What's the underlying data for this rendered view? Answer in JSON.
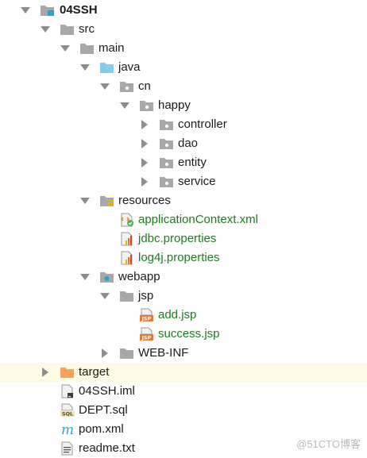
{
  "colors": {
    "folder": "#a8a8a8",
    "source_folder": "#82cdea",
    "excluded_folder": "#f3a35c",
    "module_badge": "#1fa7db",
    "selected_row": "#fdfbe3",
    "vcs_added_text": "#1e7b1e",
    "arrow": "#8e8e8e"
  },
  "tree": {
    "root": {
      "label": "04SSH",
      "icon": "module-folder-icon"
    },
    "src": {
      "label": "src",
      "icon": "folder-icon"
    },
    "main": {
      "label": "main",
      "icon": "folder-icon"
    },
    "java": {
      "label": "java",
      "icon": "source-root-folder-icon"
    },
    "cn": {
      "label": "cn",
      "icon": "package-icon"
    },
    "happy": {
      "label": "happy",
      "icon": "package-icon"
    },
    "controller": {
      "label": "controller",
      "icon": "package-icon"
    },
    "dao": {
      "label": "dao",
      "icon": "package-icon"
    },
    "entity": {
      "label": "entity",
      "icon": "package-icon"
    },
    "service": {
      "label": "service",
      "icon": "package-icon"
    },
    "resources": {
      "label": "resources",
      "icon": "resources-root-folder-icon"
    },
    "applicationContext": {
      "label": "applicationContext.xml",
      "icon": "spring-xml-file-icon"
    },
    "jdbc": {
      "label": "jdbc.properties",
      "icon": "properties-file-icon"
    },
    "log4j": {
      "label": "log4j.properties",
      "icon": "properties-file-icon"
    },
    "webapp": {
      "label": "webapp",
      "icon": "web-folder-icon"
    },
    "jsp": {
      "label": "jsp",
      "icon": "folder-icon"
    },
    "add": {
      "label": "add.jsp",
      "icon": "jsp-file-icon",
      "badge": "JSP"
    },
    "success": {
      "label": "success.jsp",
      "icon": "jsp-file-icon",
      "badge": "JSP"
    },
    "webinf": {
      "label": "WEB-INF",
      "icon": "folder-icon"
    },
    "target": {
      "label": "target",
      "icon": "excluded-folder-icon"
    },
    "iml": {
      "label": "04SSH.iml",
      "icon": "iml-file-icon"
    },
    "dept": {
      "label": "DEPT.sql",
      "icon": "sql-file-icon",
      "badge": "SQL"
    },
    "pom": {
      "label": "pom.xml",
      "icon": "maven-file-icon",
      "badge": "m"
    },
    "readme": {
      "label": "readme.txt",
      "icon": "text-file-icon"
    }
  },
  "watermark": "@51CTO博客"
}
